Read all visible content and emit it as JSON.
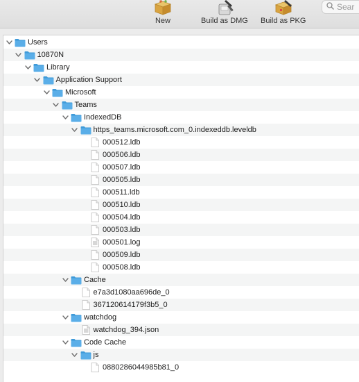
{
  "toolbar": {
    "new_label": "New",
    "build_dmg_label": "Build as DMG",
    "build_pkg_label": "Build as PKG",
    "search_placeholder": "Sear"
  },
  "tree": [
    {
      "label": "Users",
      "depth": 0,
      "type": "folder",
      "expanded": true
    },
    {
      "label": "10870N",
      "depth": 1,
      "type": "folder",
      "expanded": true
    },
    {
      "label": "Library",
      "depth": 2,
      "type": "folder",
      "expanded": true
    },
    {
      "label": "Application Support",
      "depth": 3,
      "type": "folder",
      "expanded": true
    },
    {
      "label": "Microsoft",
      "depth": 4,
      "type": "folder",
      "expanded": true
    },
    {
      "label": "Teams",
      "depth": 5,
      "type": "folder",
      "expanded": true
    },
    {
      "label": "IndexedDB",
      "depth": 6,
      "type": "folder",
      "expanded": true
    },
    {
      "label": "https_teams.microsoft.com_0.indexeddb.leveldb",
      "depth": 7,
      "type": "folder",
      "expanded": true
    },
    {
      "label": "000512.ldb",
      "depth": 8,
      "type": "file"
    },
    {
      "label": "000506.ldb",
      "depth": 8,
      "type": "file"
    },
    {
      "label": "000507.ldb",
      "depth": 8,
      "type": "file"
    },
    {
      "label": "000505.ldb",
      "depth": 8,
      "type": "file"
    },
    {
      "label": "000511.ldb",
      "depth": 8,
      "type": "file"
    },
    {
      "label": "000510.ldb",
      "depth": 8,
      "type": "file"
    },
    {
      "label": "000504.ldb",
      "depth": 8,
      "type": "file"
    },
    {
      "label": "000503.ldb",
      "depth": 8,
      "type": "file"
    },
    {
      "label": "000501.log",
      "depth": 8,
      "type": "textfile"
    },
    {
      "label": "000509.ldb",
      "depth": 8,
      "type": "file"
    },
    {
      "label": "000508.ldb",
      "depth": 8,
      "type": "file"
    },
    {
      "label": "Cache",
      "depth": 6,
      "type": "folder",
      "expanded": true
    },
    {
      "label": "e7a3d1080aa696de_0",
      "depth": 7,
      "type": "file"
    },
    {
      "label": "367120614179f3b5_0",
      "depth": 7,
      "type": "file"
    },
    {
      "label": "watchdog",
      "depth": 6,
      "type": "folder",
      "expanded": true
    },
    {
      "label": "watchdog_394.json",
      "depth": 7,
      "type": "textfile"
    },
    {
      "label": "Code Cache",
      "depth": 6,
      "type": "folder",
      "expanded": true
    },
    {
      "label": "js",
      "depth": 7,
      "type": "folder",
      "expanded": true
    },
    {
      "label": "0880286044985b81_0",
      "depth": 8,
      "type": "file"
    }
  ],
  "colors": {
    "folder": "#5aaee8",
    "folder_tab": "#3e9ad9",
    "row_alt": "#f4f5f5"
  }
}
